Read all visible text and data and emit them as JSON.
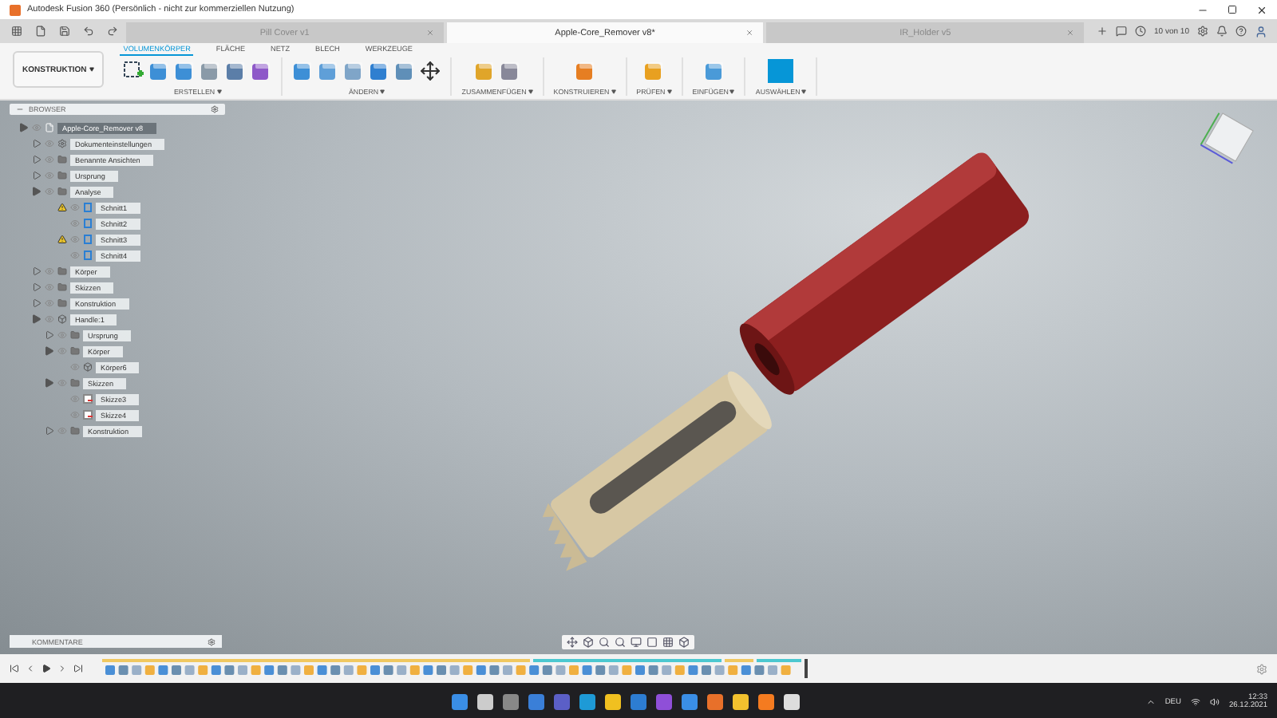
{
  "window": {
    "title": "Autodesk Fusion 360 (Persönlich - nicht zur kommerziellen Nutzung)"
  },
  "document_tabs": [
    {
      "label": "Pill Cover v1",
      "selected": false
    },
    {
      "label": "Apple-Core_Remover v8*",
      "selected": true
    },
    {
      "label": "IR_Holder v5",
      "selected": false
    }
  ],
  "job_status": "10 von 10",
  "workspace": "KONSTRUKTION",
  "toolbar_tabs": [
    {
      "label": "VOLUMENKÖRPER",
      "selected": true
    },
    {
      "label": "FLÄCHE",
      "selected": false
    },
    {
      "label": "NETZ",
      "selected": false
    },
    {
      "label": "BLECH",
      "selected": false
    },
    {
      "label": "WERKZEUGE",
      "selected": false
    }
  ],
  "tool_groups": [
    {
      "label": "ERSTELLEN"
    },
    {
      "label": "ÄNDERN"
    },
    {
      "label": "ZUSAMMENFÜGEN"
    },
    {
      "label": "KONSTRUIEREN"
    },
    {
      "label": "PRÜFEN"
    },
    {
      "label": "EINFÜGEN"
    },
    {
      "label": "AUSWÄHLEN"
    }
  ],
  "browser": {
    "title": "BROWSER",
    "tree": [
      {
        "label": "Apple-Core_Remover v8",
        "kind": "document",
        "selected": true,
        "expanded": true,
        "children": [
          {
            "label": "Dokumenteinstellungen",
            "kind": "settings",
            "selected": false,
            "expanded": false
          },
          {
            "label": "Benannte Ansichten",
            "kind": "folder",
            "selected": false,
            "expanded": false
          },
          {
            "label": "Ursprung",
            "kind": "folder",
            "selected": false,
            "expanded": false
          },
          {
            "label": "Analyse",
            "kind": "folder",
            "selected": false,
            "expanded": true,
            "children": [
              {
                "label": "Schnitt1",
                "kind": "section",
                "selected": false,
                "warning": true
              },
              {
                "label": "Schnitt2",
                "kind": "section",
                "selected": false,
                "warning": false
              },
              {
                "label": "Schnitt3",
                "kind": "section",
                "selected": false,
                "warning": true
              },
              {
                "label": "Schnitt4",
                "kind": "section",
                "selected": false,
                "warning": false
              }
            ]
          },
          {
            "label": "Körper",
            "kind": "folder",
            "selected": false,
            "expanded": false
          },
          {
            "label": "Skizzen",
            "kind": "folder",
            "selected": false,
            "expanded": false
          },
          {
            "label": "Konstruktion",
            "kind": "folder",
            "selected": false,
            "expanded": false
          },
          {
            "label": "Handle:1",
            "kind": "component",
            "selected": false,
            "expanded": true,
            "children": [
              {
                "label": "Ursprung",
                "kind": "folder",
                "selected": false,
                "expanded": false
              },
              {
                "label": "Körper",
                "kind": "folder",
                "selected": false,
                "expanded": true,
                "children": [
                  {
                    "label": "Körper6",
                    "kind": "body",
                    "selected": false
                  }
                ]
              },
              {
                "label": "Skizzen",
                "kind": "folder",
                "selected": false,
                "expanded": true,
                "children": [
                  {
                    "label": "Skizze3",
                    "kind": "sketch",
                    "selected": false
                  },
                  {
                    "label": "Skizze4",
                    "kind": "sketch",
                    "selected": false
                  }
                ]
              },
              {
                "label": "Konstruktion",
                "kind": "folder",
                "selected": false,
                "expanded": false
              }
            ]
          }
        ]
      }
    ]
  },
  "comments": {
    "title": "KOMMENTARE"
  },
  "tray": {
    "language": "DEU",
    "time": "12:33",
    "date": "26.12.2021"
  }
}
